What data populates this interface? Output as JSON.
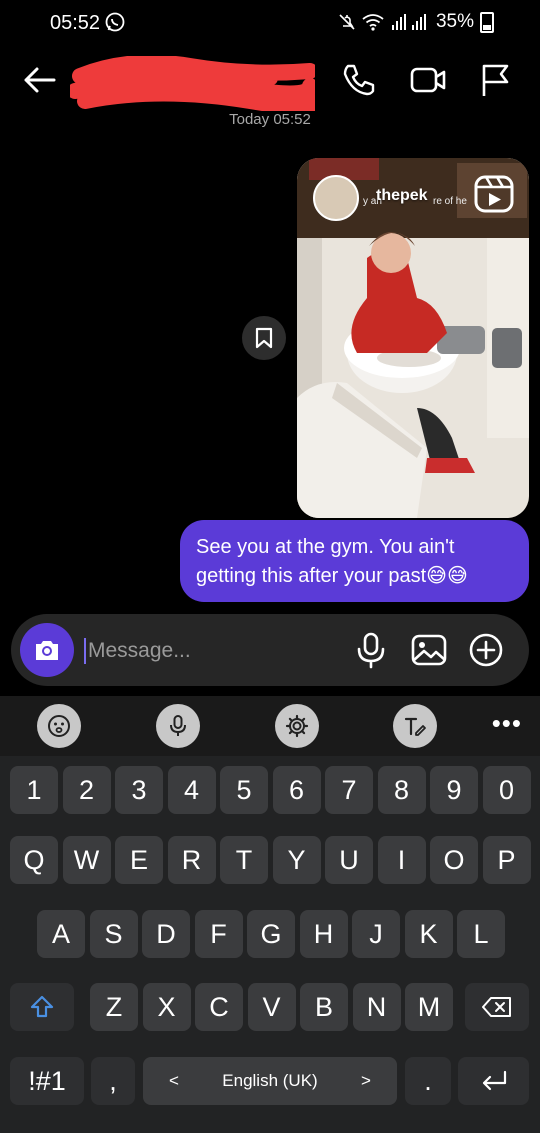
{
  "status_bar": {
    "time": "05:52",
    "battery": "35%"
  },
  "conversation": {
    "date_separator": "Today 05:52"
  },
  "shared_post": {
    "prefix_text": "y an",
    "username": "thepek",
    "suffix_text": "re of he"
  },
  "message": {
    "text": "See you at the gym. You ain't getting this after your past😅😅"
  },
  "composer": {
    "placeholder": "Message..."
  },
  "keyboard": {
    "number_row": [
      "1",
      "2",
      "3",
      "4",
      "5",
      "6",
      "7",
      "8",
      "9",
      "0"
    ],
    "row1": [
      "Q",
      "W",
      "E",
      "R",
      "T",
      "Y",
      "U",
      "I",
      "O",
      "P"
    ],
    "row2": [
      "A",
      "S",
      "D",
      "F",
      "G",
      "H",
      "J",
      "K",
      "L"
    ],
    "row3": [
      "Z",
      "X",
      "C",
      "V",
      "B",
      "N",
      "M"
    ],
    "symbols_label": "!#1",
    "comma": ",",
    "period": ".",
    "language": "English (UK)",
    "lang_prev": "<",
    "lang_next": ">"
  },
  "colors": {
    "accent": "#5b3bd7",
    "keyboard_bg": "#222324",
    "key_bg": "#3b3c3e"
  }
}
